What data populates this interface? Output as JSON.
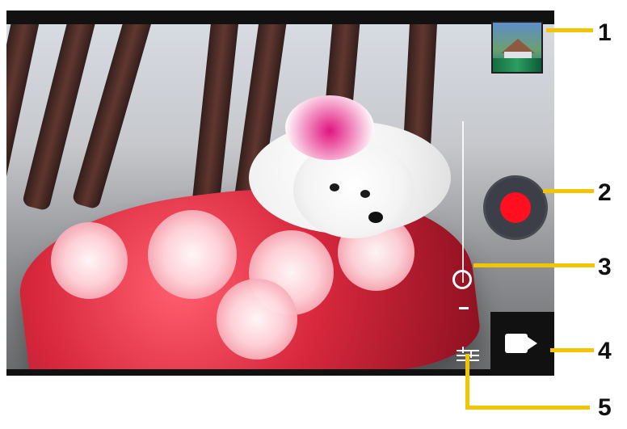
{
  "screenshot": {
    "callouts": [
      "1",
      "2",
      "3",
      "4",
      "5"
    ]
  },
  "colors": {
    "callout_line": "#f2c500",
    "record_dot": "#ff0f1f",
    "record_button": "#3c3f47",
    "panel": "#111111"
  },
  "icons": {
    "thumbnail": "image-thumbnail",
    "record": "record-icon",
    "zoom_handle": "zoom-handle-icon",
    "zoom_minus": "minus-icon",
    "settings": "sliders-icon",
    "mode": "video-camera-icon"
  }
}
